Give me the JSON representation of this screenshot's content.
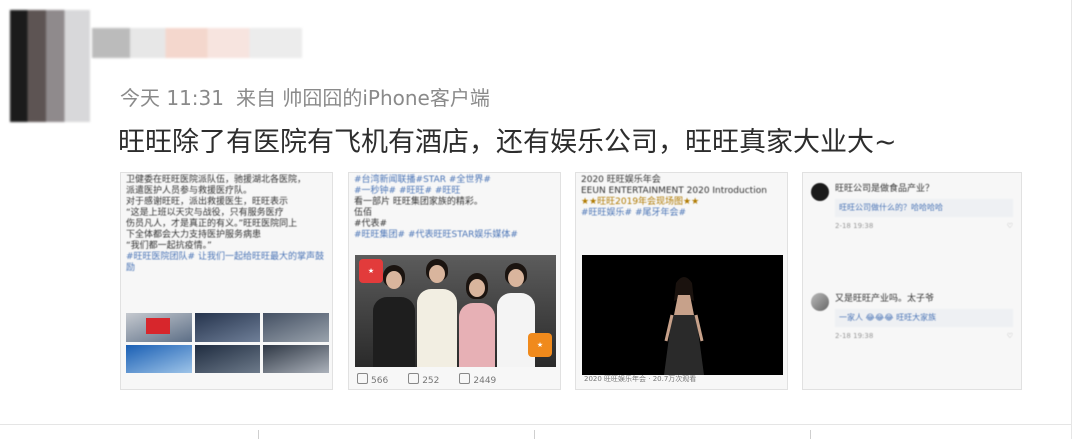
{
  "post": {
    "time": "今天 11:31",
    "source": "来自 帅囧囧的iPhone客户端",
    "text": "旺旺除了有医院有飞机有酒店，还有娱乐公司，旺旺真家大业大~"
  },
  "cards": [
    {
      "lines": [
        "卫健委在旺旺医院派队伍，驰援湖北各医院，",
        "派遣医护人员参与救援医疗队。",
        "对于感谢旺旺，派出救援医生，旺旺表示",
        "“这是上班以天灾与战役，只有服务医疗",
        "伤员凡人，才是真正的有义。”旺旺医院同上",
        "下全体都会大力支持医护服务病患",
        "“我们都一起抗疫情。”"
      ],
      "link": "#旺旺医院团队# 让我们一起给旺旺最大的掌声鼓励",
      "footer": {
        "reposts": "",
        "comments": "",
        "likes": ""
      }
    },
    {
      "lines": [
        "#台湾新闻联播#STAR #全世界#",
        "#一秒钟#  #旺旺#  #旺旺",
        "看一部片  旺旺集团家族的精彩。",
        "伍佰",
        "#代表#"
      ],
      "link": "#旺旺集团#  #代表旺旺STAR娱乐媒体#",
      "footer": {
        "reposts": "566",
        "comments": "252",
        "likes": "2449"
      }
    },
    {
      "lines": [
        "2020 旺旺娱乐年会",
        "EEUN ENTERTAINMENT 2020 Introduction",
        "★★旺旺2019年会现场图★★"
      ],
      "link": "#旺旺娱乐#  #尾牙年会#",
      "footer": {
        "reposts": "",
        "comments": "",
        "likes": ""
      },
      "caption": "2020 旺旺娱乐年会 · 20.7万次观看"
    },
    {
      "comments": [
        {
          "text": "旺旺公司是做食品产业？",
          "reply": "旺旺公司做什么的？哈哈哈哈",
          "date": "2-18 19:38"
        },
        {
          "text": "又是旺旺产业吗。太子爷",
          "reply": "一家人 😂😂😂 旺旺大家族",
          "date": "2-18 19:38"
        }
      ]
    }
  ]
}
